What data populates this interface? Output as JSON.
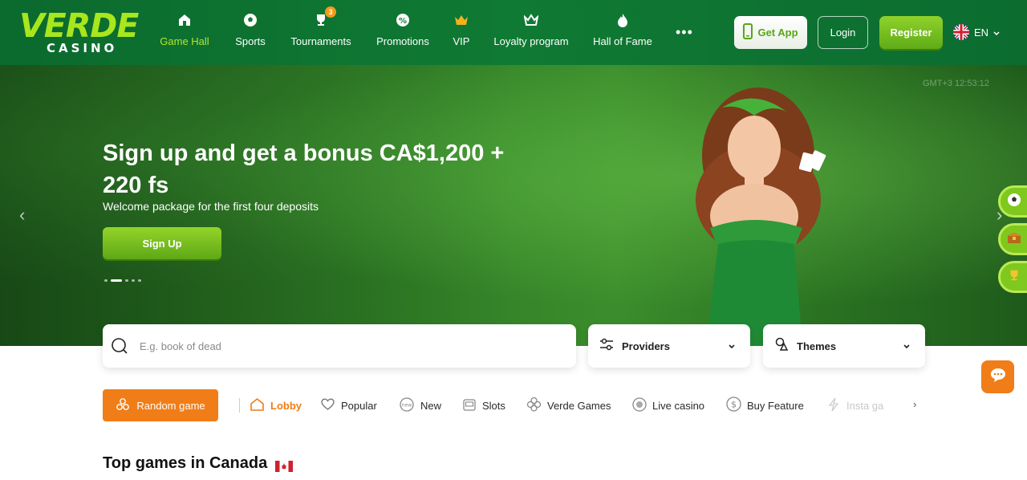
{
  "brand": {
    "logo_top": "VERDE",
    "logo_bottom": "CASINO"
  },
  "nav": {
    "items": [
      {
        "label": "Game Hall",
        "icon": "home-icon",
        "active": true
      },
      {
        "label": "Sports",
        "icon": "soccer-ball-icon"
      },
      {
        "label": "Tournaments",
        "icon": "trophy-icon",
        "badge": "3"
      },
      {
        "label": "Promotions",
        "icon": "percent-badge-icon"
      },
      {
        "label": "VIP",
        "icon": "crown-icon"
      },
      {
        "label": "Loyalty program",
        "icon": "crown-outline-icon"
      },
      {
        "label": "Hall of Fame",
        "icon": "flame-icon"
      }
    ],
    "more": "•••"
  },
  "header_actions": {
    "get_app": "Get App",
    "login": "Login",
    "register": "Register",
    "language": "EN"
  },
  "hero": {
    "timer": "GMT+3 12:53:12",
    "title": "Sign up and get a bonus CA$1,200 + 220 fs",
    "subtitle": "Welcome package for the first four deposits",
    "cta": "Sign Up",
    "slides": 5,
    "active_slide": 2
  },
  "search": {
    "placeholder": "E.g. book of dead",
    "value": ""
  },
  "filters": {
    "providers": "Providers",
    "themes": "Themes"
  },
  "categories": {
    "random": "Random game",
    "items": [
      {
        "label": "Lobby",
        "icon": "home-outline-icon",
        "active": true
      },
      {
        "label": "Popular",
        "icon": "heart-icon"
      },
      {
        "label": "New",
        "icon": "new-tag-icon"
      },
      {
        "label": "Slots",
        "icon": "slot-machine-icon"
      },
      {
        "label": "Verde Games",
        "icon": "clover-icon"
      },
      {
        "label": "Live casino",
        "icon": "live-dot-icon"
      },
      {
        "label": "Buy Feature",
        "icon": "dollar-coin-icon"
      },
      {
        "label": "Insta ga",
        "icon": "lightning-icon"
      }
    ]
  },
  "section": {
    "title": "Top games in Canada"
  },
  "colors": {
    "header_green": "#0f7a33",
    "accent_lime": "#8fd22a",
    "accent_orange": "#f07d18"
  }
}
